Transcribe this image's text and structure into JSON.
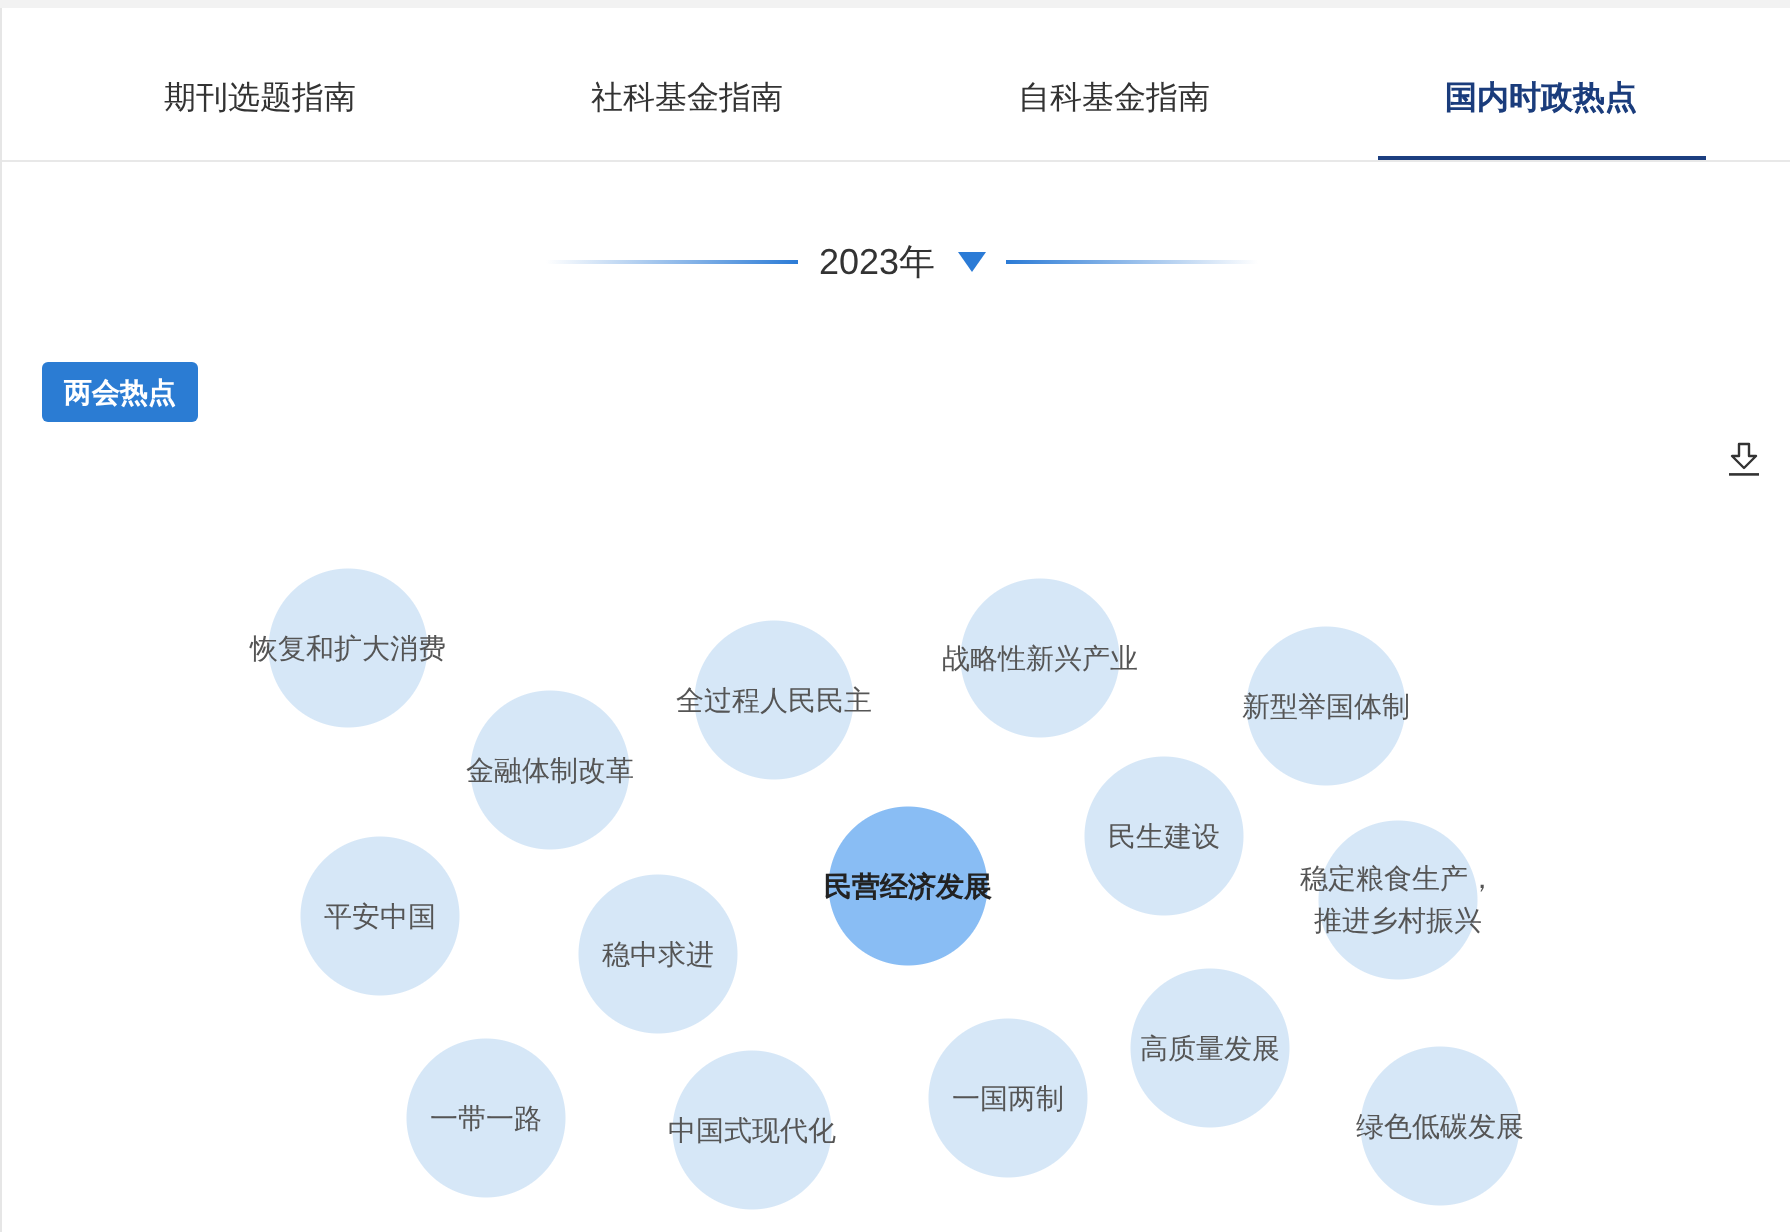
{
  "tabs": [
    {
      "label": "期刊选题指南",
      "selected": false
    },
    {
      "label": "社科基金指南",
      "selected": false
    },
    {
      "label": "自科基金指南",
      "selected": false
    },
    {
      "label": "国内时政热点",
      "selected": true
    }
  ],
  "year_selector": {
    "value": "2023年"
  },
  "tag_button": {
    "label": "两会热点"
  },
  "bubbles": [
    {
      "label": "恢复和扩大消费",
      "selected": false
    },
    {
      "label": "全过程人民民主",
      "selected": false
    },
    {
      "label": "战略性新兴产业",
      "selected": false
    },
    {
      "label": "新型举国体制",
      "selected": false
    },
    {
      "label": "金融体制改革",
      "selected": false
    },
    {
      "label": "民生建设",
      "selected": false
    },
    {
      "label": "平安中国",
      "selected": false
    },
    {
      "label": "稳中求进",
      "selected": false
    },
    {
      "label": "民营经济发展",
      "selected": true
    },
    {
      "label": "稳定粮食生产，推进乡村振兴",
      "selected": false
    },
    {
      "label": "一带一路",
      "selected": false
    },
    {
      "label": "中国式现代化",
      "selected": false
    },
    {
      "label": "一国两制",
      "selected": false
    },
    {
      "label": "高质量发展",
      "selected": false
    },
    {
      "label": "绿色低碳发展",
      "selected": false
    }
  ]
}
